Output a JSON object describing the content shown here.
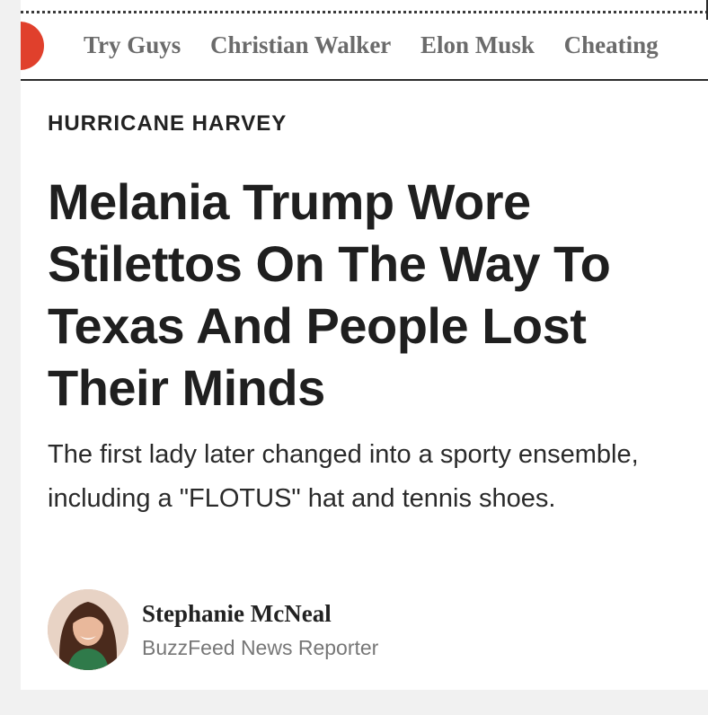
{
  "nav": {
    "links": [
      "Try Guys",
      "Christian Walker",
      "Elon Musk",
      "Cheating"
    ]
  },
  "article": {
    "section": "HURRICANE HARVEY",
    "headline": "Melania Trump Wore Stilettos On The Way To Texas And People Lost Their Minds",
    "dek": "The first lady later changed into a sporty ensemble, including a \"FLOTUS\" hat and tennis shoes."
  },
  "byline": {
    "author": "Stephanie McNeal",
    "role": "BuzzFeed News Reporter"
  },
  "colors": {
    "accent": "#e0402c",
    "nav_text": "#6b6b6b",
    "headline": "#1f1f1f",
    "background": "#f1f1f1"
  }
}
